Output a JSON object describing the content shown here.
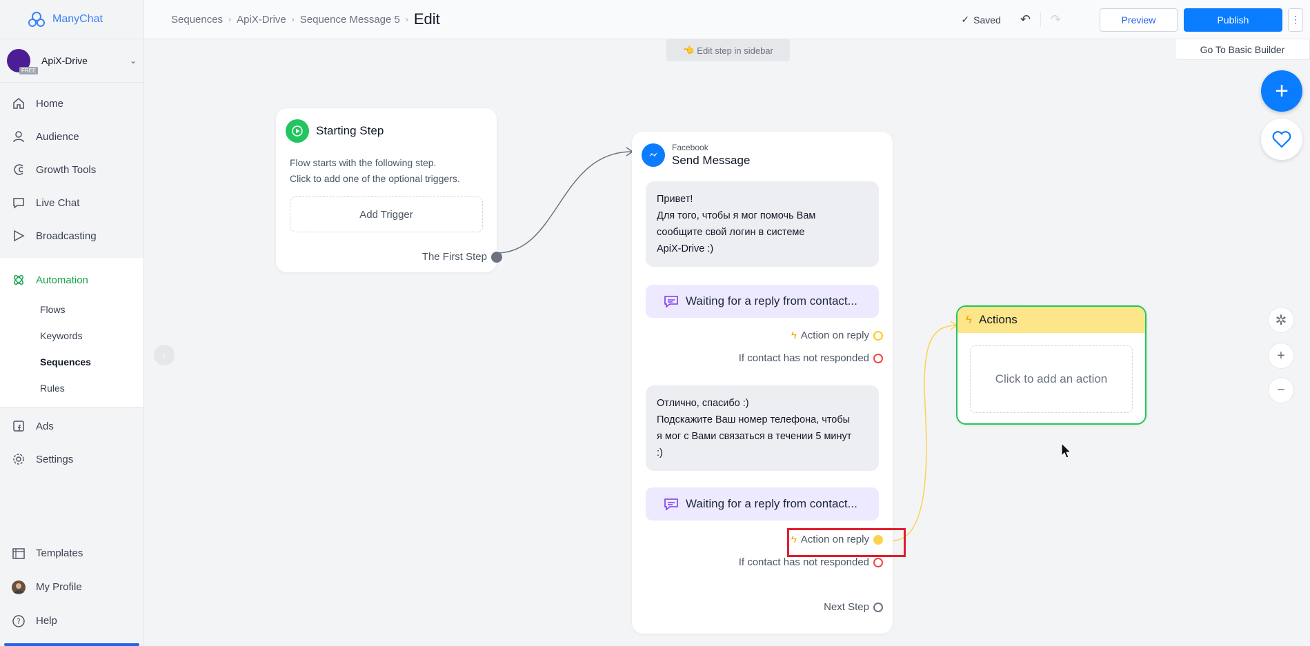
{
  "app": {
    "name": "ManyChat"
  },
  "account": {
    "name": "ApiX-Drive",
    "badge": "FREE"
  },
  "sidebar": {
    "items": [
      {
        "label": "Home",
        "icon": "home-icon"
      },
      {
        "label": "Audience",
        "icon": "user-icon"
      },
      {
        "label": "Growth Tools",
        "icon": "magnet-icon"
      },
      {
        "label": "Live Chat",
        "icon": "chat-icon"
      },
      {
        "label": "Broadcasting",
        "icon": "send-icon"
      }
    ],
    "automation": {
      "label": "Automation",
      "sub": [
        "Flows",
        "Keywords",
        "Sequences",
        "Rules"
      ],
      "active_sub": "Sequences"
    },
    "items_after": [
      {
        "label": "Ads",
        "icon": "facebook-icon"
      },
      {
        "label": "Settings",
        "icon": "gear-icon"
      }
    ],
    "bottom": [
      {
        "label": "Templates",
        "icon": "templates-icon"
      },
      {
        "label": "My Profile",
        "icon": "avatar"
      },
      {
        "label": "Help",
        "icon": "help-icon"
      }
    ]
  },
  "header": {
    "breadcrumbs": [
      "Sequences",
      "ApiX-Drive",
      "Sequence Message 5"
    ],
    "title": "Edit",
    "saved": "Saved",
    "preview": "Preview",
    "publish": "Publish"
  },
  "canvas": {
    "hint": "Edit step in sidebar",
    "basic_builder": "Go To Basic Builder",
    "start": {
      "title": "Starting Step",
      "desc1": "Flow starts with the following step.",
      "desc2": "Click to add one of the optional triggers.",
      "add_trigger": "Add Trigger",
      "first_step": "The First Step"
    },
    "message": {
      "source": "Facebook",
      "title": "Send Message",
      "bubble1": [
        "Привет!",
        "Для того, чтобы я мог помочь Вам",
        "сообщите свой логин в системе",
        "ApiX-Drive :)"
      ],
      "waiting": "Waiting for a reply from contact...",
      "action_on_reply": "Action on reply",
      "not_responded": "If contact has not responded",
      "bubble2": [
        "Отлично, спасибо :)",
        "Подскажите Ваш номер телефона, чтобы",
        "я мог с Вами связаться в течении 5 минут",
        ":)"
      ],
      "next_step": "Next Step"
    },
    "actions": {
      "title": "Actions",
      "add": "Click to add an action"
    }
  },
  "colors": {
    "accent": "#0a7cff",
    "automation": "#16a34a",
    "highlight": "#e11d2e"
  }
}
